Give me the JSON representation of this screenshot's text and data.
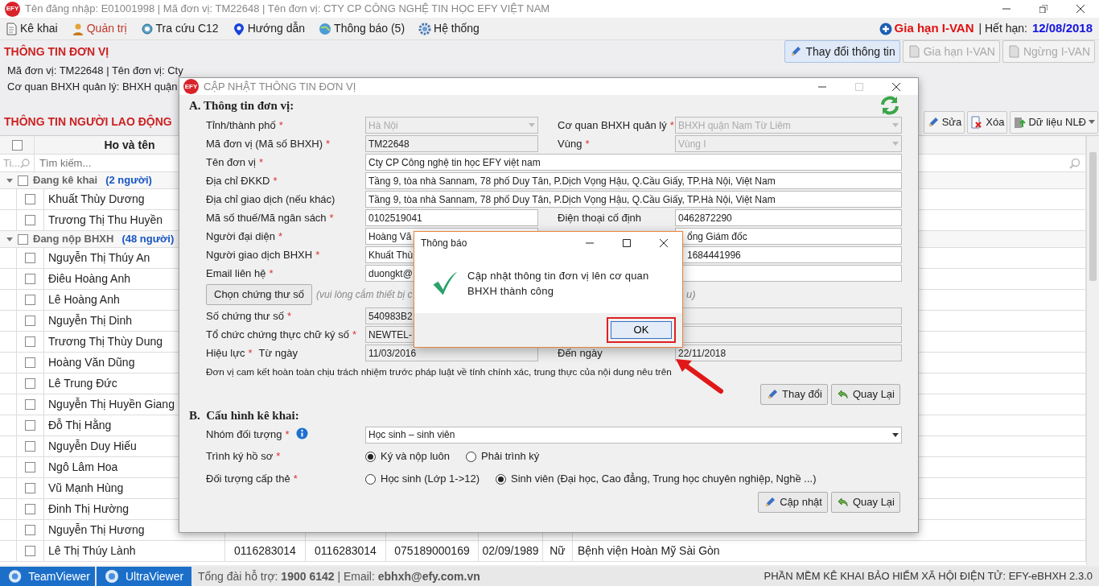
{
  "app_title": {
    "logo": "EFY",
    "text": "Tên đăng nhập: E01001998 | Mã đơn vị: TM22648 | Tên đơn vị: CTY CP CÔNG NGHỆ TIN HỌC EFY VIỆT NAM"
  },
  "menu": [
    {
      "label": "Kê khai",
      "kind": "document",
      "selected": false
    },
    {
      "label": "Quản trị",
      "kind": "user",
      "selected": true
    },
    {
      "label": "Tra cứu C12",
      "kind": "lookup",
      "selected": false
    },
    {
      "label": "Hướng dẫn",
      "kind": "help",
      "selected": false
    },
    {
      "label": "Thông báo (5)",
      "kind": "globe",
      "selected": false
    },
    {
      "label": "Hệ thống",
      "kind": "gear",
      "selected": false
    }
  ],
  "ivan": {
    "renew": "Gia hạn I-VAN",
    "expiry_label": "| Hết hạn:",
    "expiry": "12/08/2018"
  },
  "unit_section": {
    "title": "THÔNG TIN ĐƠN VỊ",
    "buttons": [
      {
        "label": "Thay đổi thông tin",
        "kind": "edit",
        "disabled": false
      },
      {
        "label": "Gia hạn I-VAN",
        "kind": "renew",
        "disabled": true
      },
      {
        "label": "Ngừng I-VAN",
        "kind": "stop",
        "disabled": true
      }
    ],
    "lines": [
      "Mã đơn vị: TM22648 | Tên đơn vị: Cty",
      "Cơ quan BHXH quản lý: BHXH quận"
    ]
  },
  "employee_section": {
    "title": "THÔNG TIN NGƯỜI LAO ĐỘNG",
    "buttons": [
      {
        "label": "Sửa",
        "kind": "edit"
      },
      {
        "label": "Xóa",
        "kind": "delete"
      },
      {
        "label": "Dữ liệu NLĐ",
        "kind": "data"
      }
    ],
    "grid": {
      "select_all_checked": false,
      "header": "Ho và tên",
      "search_short": "Ti...",
      "search_placeholder": "Tìm kiếm...",
      "groups": [
        {
          "title": "Đang kê khai",
          "count": "(2 người)",
          "expanded": true,
          "checked": false,
          "rows": [
            {
              "name": "Khuất Thùy Dương",
              "checked": false
            },
            {
              "name": "Trương Thị Thu Huyền",
              "checked": false
            }
          ]
        },
        {
          "title": "Đang nộp BHXH",
          "count": "(48 người)",
          "expanded": true,
          "checked": false,
          "rows": [
            {
              "name": "Nguyễn Thị Thúy An",
              "checked": false
            },
            {
              "name": "Điêu Hoàng Anh",
              "checked": false
            },
            {
              "name": "Lê Hoàng Anh",
              "checked": false
            },
            {
              "name": "Nguyễn Thị Dinh",
              "checked": false
            },
            {
              "name": "Trương Thị Thùy Dung",
              "checked": false
            },
            {
              "name": "Hoàng Văn Dũng",
              "checked": false
            },
            {
              "name": "Lê Trung Đức",
              "checked": false
            },
            {
              "name": "Nguyễn Thị Huyền Giang",
              "checked": false
            },
            {
              "name": "Đỗ Thị Hằng",
              "checked": false
            },
            {
              "name": "Nguyễn Duy Hiếu",
              "checked": false
            },
            {
              "name": "Ngô Lâm Hoa",
              "checked": false
            },
            {
              "name": "Vũ Mạnh Hùng",
              "checked": false
            },
            {
              "name": "Đinh Thị Hường",
              "checked": false
            },
            {
              "name": "Nguyễn Thị Hương",
              "checked": false
            },
            {
              "name": "Lê Thị Thúy Lành",
              "checked": false,
              "cells": [
                "0116283014",
                "0116283014",
                "075189000169",
                "02/09/1989",
                "Nữ",
                "Bệnh viện Hoàn Mỹ Sài Gòn"
              ]
            }
          ]
        }
      ]
    }
  },
  "status_bar": {
    "apps": [
      {
        "label": "TeamViewer"
      },
      {
        "label": "UltraViewer"
      }
    ],
    "support": "Tổng đài hỗ trợ: **1900 6142** | Email: **ebhxh@efy.com.vn**",
    "version": "PHẦN MỀM KÊ KHAI BẢO HIỂM XÃ HỘI ĐIỆN TỬ: EFY-eBHXH 2.3.0"
  },
  "dialog": {
    "logo": "EFY",
    "title": "CẬP NHẬT THÔNG TIN ĐƠN VỊ",
    "section_a": "A. Thông tin đơn vị:",
    "rows": [
      {
        "kind": "field",
        "label": "Tỉnh/thành phố",
        "required_mark": "*",
        "field": {
          "kind": "select",
          "value": "Hà Nội",
          "disabled": true
        },
        "right": {
          "label": "Cơ quan BHXH quản lý",
          "required_mark": "*",
          "field": {
            "kind": "select",
            "value": "BHXH quận Nam Từ Liêm",
            "disabled": true
          }
        }
      },
      {
        "kind": "field",
        "label": "Mã đơn vị (Mã số BHXH)",
        "required_mark": "*",
        "field": {
          "kind": "text",
          "value": "TM22648",
          "disabled": true
        },
        "right": {
          "label": "Vùng",
          "required_mark": "*",
          "field": {
            "kind": "select",
            "value": "Vùng I",
            "disabled": true
          }
        }
      },
      {
        "kind": "field",
        "label": "Tên đơn vị",
        "required_mark": "*",
        "field": {
          "kind": "text",
          "value": "Cty CP Công nghệ tin học EFY việt nam",
          "disabled": false
        }
      },
      {
        "kind": "field",
        "label": "Địa chỉ ĐKKD",
        "required_mark": "*",
        "field": {
          "kind": "text",
          "value": "Tầng 9, tòa nhà Sannam, 78 phố Duy Tân, P.Dịch Vọng Hậu, Q.Cầu Giấy, TP.Hà Nội, Việt Nam",
          "disabled": false
        }
      },
      {
        "kind": "field",
        "label": "Địa chỉ giao dịch (nếu khác)",
        "field": {
          "kind": "text",
          "value": "Tầng 9, tòa nhà Sannam, 78 phố Duy Tân, P.Dịch Vọng Hậu, Q.Cầu Giấy, TP.Hà Nội, Việt Nam",
          "disabled": false
        }
      },
      {
        "kind": "field",
        "label": "Mã số thuế/Mã ngân sách",
        "required_mark": "*",
        "field": {
          "kind": "text",
          "value": "0102519041",
          "disabled": false
        },
        "right": {
          "label": "Điện thoại cố định",
          "field": {
            "kind": "text",
            "value": "0462872290",
            "disabled": false
          }
        }
      },
      {
        "kind": "field",
        "label": "Người đại diện",
        "required_mark": "*",
        "field": {
          "kind": "text",
          "value": "Hoàng Vă",
          "disabled": false
        },
        "right": {
          "field": {
            "kind": "text",
            "value": "ổng Giám đốc",
            "disabled": false
          }
        }
      },
      {
        "kind": "field",
        "label": "Người giao dịch BHXH",
        "required_mark": "*",
        "field": {
          "kind": "text",
          "value": "Khuất Thù",
          "disabled": false
        },
        "right": {
          "field": {
            "kind": "text",
            "value": "1684441996",
            "disabled": false
          }
        }
      },
      {
        "kind": "field",
        "label": "Email liên hệ",
        "required_mark": "*",
        "field": {
          "kind": "text",
          "value": "duongkt@",
          "disabled": false
        }
      },
      {
        "kind": "certificate",
        "button": "Chọn chứng thư số",
        "hint": "(vui lòng cắm thiết bị c",
        "hint_tail": "u)"
      },
      {
        "kind": "field",
        "label": "Số chứng thư số",
        "required_mark": "*",
        "field": {
          "kind": "text",
          "value": "540983B2",
          "disabled": true
        }
      },
      {
        "kind": "field",
        "label": "Tổ chức chứng thực chữ ký số",
        "required_mark": "*",
        "field": {
          "kind": "text",
          "value": "NEWTEL-",
          "disabled": true
        }
      },
      {
        "kind": "field",
        "label": "Hiệu lực",
        "required_mark": "*",
        "sublabel": "Từ ngày",
        "field": {
          "kind": "text",
          "value": "11/03/2016",
          "disabled": true
        },
        "right": {
          "label": "Đến ngày",
          "field": {
            "kind": "text",
            "value": "22/11/2018",
            "disabled": true
          }
        }
      }
    ],
    "commitment": "Đơn vị cam kết hoàn toàn chịu trách nhiệm trước pháp luật về tính chính xác, trung thực của nội dung nêu trên",
    "buttons_a": [
      {
        "label": "Thay đổi",
        "kind": "edit"
      },
      {
        "label": "Quay Lại",
        "kind": "back"
      }
    ],
    "section_b": "B.  Cấu hình kê khai:",
    "config": [
      {
        "kind": "select",
        "label": "Nhóm đối tượng",
        "required_mark": "*",
        "has_info": true,
        "value": "Học sinh – sinh viên"
      },
      {
        "kind": "radio",
        "label": "Trình ký hồ sơ",
        "required_mark": "*",
        "options": [
          {
            "label": "Ký và nộp luôn",
            "selected": true
          },
          {
            "label": "Phải trình ký",
            "selected": false
          }
        ]
      },
      {
        "kind": "radio",
        "label": "Đối tượng cấp thẻ",
        "required_mark": "*",
        "options": [
          {
            "label": "Học sinh (Lớp 1->12)",
            "selected": false
          },
          {
            "label": "Sinh viên (Đại học, Cao đẳng, Trung học chuyên nghiệp, Nghề ...)",
            "selected": true
          }
        ]
      }
    ],
    "buttons_b": [
      {
        "label": "Cập nhật",
        "kind": "edit"
      },
      {
        "label": "Quay Lại",
        "kind": "back"
      }
    ]
  },
  "message": {
    "title": "Thông báo",
    "text": "Cập nhật thông tin đơn vị lên cơ quan BHXH thành công",
    "ok": "OK",
    "highlighted": true
  }
}
